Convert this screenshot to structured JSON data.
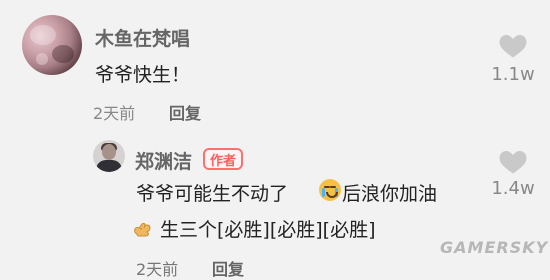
{
  "comments": [
    {
      "username": "木鱼在梵唱",
      "text": "爷爷快生！",
      "meta_time": "2天前",
      "reply_label": "回复",
      "likes": "1.1w"
    }
  ],
  "reply_comment": {
    "username": "郑渊洁",
    "author_badge": "作者",
    "line1_prefix": "爷爷可能生不动了",
    "line1_suffix": "后浪你加油",
    "line2_text": "生三个[必胜][必胜][必胜]",
    "likes": "1.4w"
  },
  "partial_footer": {
    "time": "2天前",
    "reply": "回复"
  },
  "watermark": "GAMERSKY",
  "icons": {
    "like": "heart-icon",
    "crying": "crying-emoji-icon",
    "flex": "flexed-biceps-icon"
  },
  "colors": {
    "background": "#f3f2f3",
    "author_badge": "#ff5f5f",
    "heart": "#c9c9c9"
  }
}
